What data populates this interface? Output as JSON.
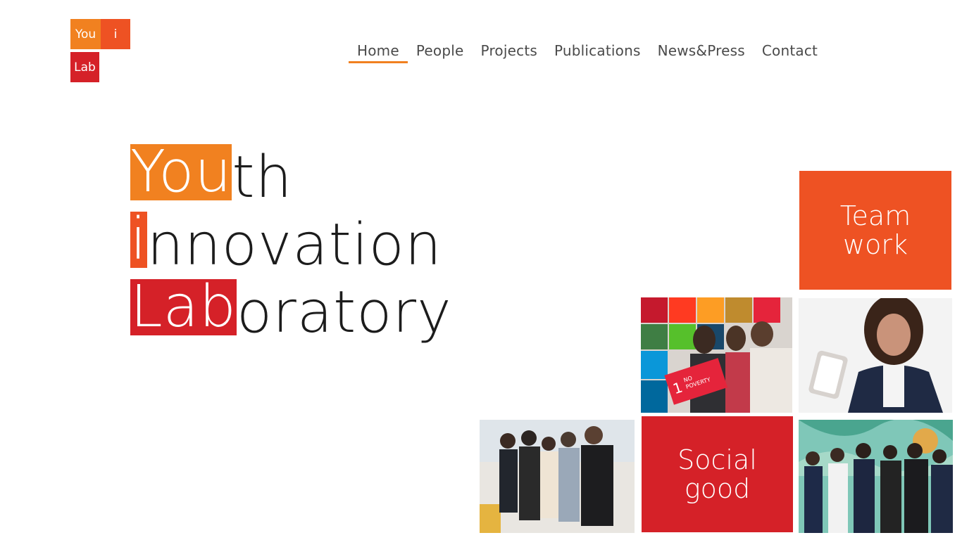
{
  "logo": {
    "you": "You",
    "i": "i",
    "lab": "Lab"
  },
  "nav": {
    "items": [
      {
        "label": "Home",
        "active": true
      },
      {
        "label": "People",
        "active": false
      },
      {
        "label": "Projects",
        "active": false
      },
      {
        "label": "Publications",
        "active": false
      },
      {
        "label": "News&Press",
        "active": false
      },
      {
        "label": "Contact",
        "active": false
      }
    ]
  },
  "hero": {
    "line1": {
      "highlight": "You",
      "rest": "th"
    },
    "line2": {
      "highlight": "i",
      "rest": "nnovation"
    },
    "line3": {
      "highlight": "Lab",
      "rest": "oratory"
    }
  },
  "tiles": {
    "teamwork": {
      "line1": "Team",
      "line2": "work"
    },
    "socialgood": {
      "line1": "Social",
      "line2": "good"
    }
  },
  "photos": {
    "sdg_sign": {
      "line1": "NO",
      "line2": "POVERTY",
      "number": "1"
    }
  },
  "colors": {
    "orange": "#f18120",
    "red_orange": "#ee5223",
    "red": "#d52128",
    "nav_text": "#4a4a4a"
  }
}
